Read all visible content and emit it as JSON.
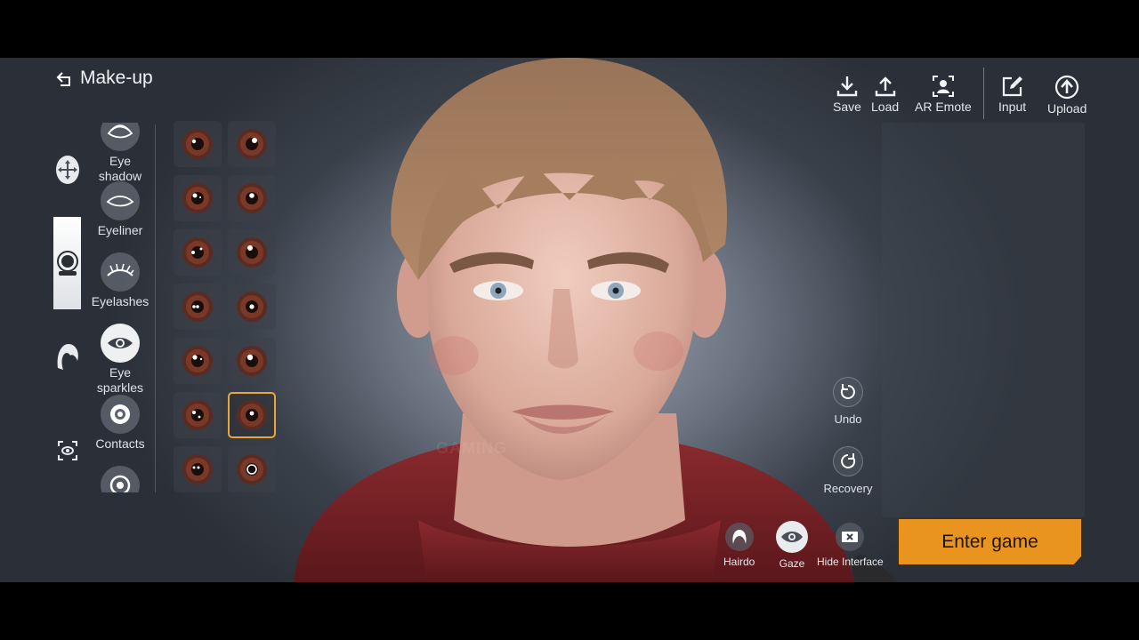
{
  "header": {
    "title": "Make-up"
  },
  "categories": [
    {
      "icon": "face-move-icon",
      "active": false
    },
    {
      "icon": "compact-mirror-icon",
      "active": true
    },
    {
      "icon": "hair-icon",
      "active": false
    },
    {
      "icon": "eye-frame-icon",
      "active": false
    }
  ],
  "submenu": [
    {
      "label": "Eye shadow",
      "icon": "eye-shadow-icon"
    },
    {
      "label": "Eyeliner",
      "icon": "eyeliner-icon"
    },
    {
      "label": "Eyelashes",
      "icon": "eyelashes-icon"
    },
    {
      "label": "Eye sparkles",
      "icon": "eye-sparkles-icon",
      "selected": true
    },
    {
      "label": "Contacts",
      "icon": "contacts-icon"
    }
  ],
  "sparkle_grid": {
    "rows": 7,
    "columns": 2,
    "selected_row": 6,
    "selected_col": 2,
    "accent": "#e8a73a"
  },
  "toolbar": {
    "save": "Save",
    "load": "Load",
    "ar_emote": "AR Emote",
    "input": "Input",
    "upload": "Upload"
  },
  "side": {
    "undo": "Undo",
    "recovery": "Recovery"
  },
  "bottom": {
    "hairdo": "Hairdo",
    "gaze": "Gaze",
    "hide_interface": "Hide Interface"
  },
  "enter_game": "Enter game",
  "colors": {
    "enter_button": "#ea9420",
    "selected_border": "#e8a73a"
  }
}
